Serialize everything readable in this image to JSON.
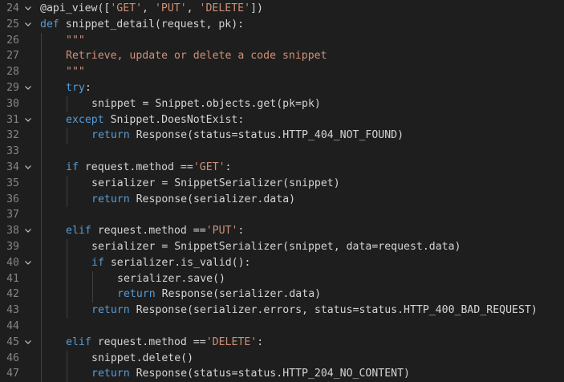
{
  "editor": {
    "lines": [
      {
        "n": "24",
        "fold": true,
        "indent": 0,
        "tokens": [
          {
            "c": "txt",
            "t": "@api_view(["
          },
          {
            "c": "str",
            "t": "'GET'"
          },
          {
            "c": "txt",
            "t": ", "
          },
          {
            "c": "str",
            "t": "'PUT'"
          },
          {
            "c": "txt",
            "t": ", "
          },
          {
            "c": "str",
            "t": "'DELETE'"
          },
          {
            "c": "txt",
            "t": "])"
          }
        ]
      },
      {
        "n": "25",
        "fold": true,
        "indent": 0,
        "tokens": [
          {
            "c": "kw",
            "t": "def"
          },
          {
            "c": "txt",
            "t": " snippet_detail(request, pk):"
          }
        ]
      },
      {
        "n": "26",
        "fold": false,
        "indent": 1,
        "tokens": [
          {
            "c": "cmt",
            "t": "\"\"\""
          }
        ]
      },
      {
        "n": "27",
        "fold": false,
        "indent": 1,
        "tokens": [
          {
            "c": "cmt",
            "t": "Retrieve, update or delete a code snippet"
          }
        ]
      },
      {
        "n": "28",
        "fold": false,
        "indent": 1,
        "tokens": [
          {
            "c": "cmt",
            "t": "\"\"\""
          }
        ]
      },
      {
        "n": "29",
        "fold": true,
        "indent": 1,
        "tokens": [
          {
            "c": "kw",
            "t": "try"
          },
          {
            "c": "txt",
            "t": ":"
          }
        ]
      },
      {
        "n": "30",
        "fold": false,
        "indent": 2,
        "tokens": [
          {
            "c": "txt",
            "t": "snippet = Snippet.objects.get(pk=pk)"
          }
        ]
      },
      {
        "n": "31",
        "fold": true,
        "indent": 1,
        "tokens": [
          {
            "c": "kw",
            "t": "except"
          },
          {
            "c": "txt",
            "t": " Snippet.DoesNotExist:"
          }
        ]
      },
      {
        "n": "32",
        "fold": false,
        "indent": 2,
        "tokens": [
          {
            "c": "kw",
            "t": "return"
          },
          {
            "c": "txt",
            "t": " Response(status=status.HTTP_404_NOT_FOUND)"
          }
        ]
      },
      {
        "n": "33",
        "fold": false,
        "indent": 0,
        "tokens": []
      },
      {
        "n": "34",
        "fold": true,
        "indent": 1,
        "tokens": [
          {
            "c": "kw",
            "t": "if"
          },
          {
            "c": "txt",
            "t": " request.method =="
          },
          {
            "c": "str",
            "t": "'GET'"
          },
          {
            "c": "txt",
            "t": ":"
          }
        ]
      },
      {
        "n": "35",
        "fold": false,
        "indent": 2,
        "tokens": [
          {
            "c": "txt",
            "t": "serializer = SnippetSerializer(snippet)"
          }
        ]
      },
      {
        "n": "36",
        "fold": false,
        "indent": 2,
        "tokens": [
          {
            "c": "kw",
            "t": "return"
          },
          {
            "c": "txt",
            "t": " Response(serializer.data)"
          }
        ]
      },
      {
        "n": "37",
        "fold": false,
        "indent": 0,
        "tokens": []
      },
      {
        "n": "38",
        "fold": true,
        "indent": 1,
        "tokens": [
          {
            "c": "kw",
            "t": "elif"
          },
          {
            "c": "txt",
            "t": " request.method =="
          },
          {
            "c": "str",
            "t": "'PUT'"
          },
          {
            "c": "txt",
            "t": ":"
          }
        ]
      },
      {
        "n": "39",
        "fold": false,
        "indent": 2,
        "tokens": [
          {
            "c": "txt",
            "t": "serializer = SnippetSerializer(snippet, data=request.data)"
          }
        ]
      },
      {
        "n": "40",
        "fold": true,
        "indent": 2,
        "tokens": [
          {
            "c": "kw",
            "t": "if"
          },
          {
            "c": "txt",
            "t": " serializer.is_valid():"
          }
        ]
      },
      {
        "n": "41",
        "fold": false,
        "indent": 3,
        "tokens": [
          {
            "c": "txt",
            "t": "serializer.save()"
          }
        ]
      },
      {
        "n": "42",
        "fold": false,
        "indent": 3,
        "tokens": [
          {
            "c": "kw",
            "t": "return"
          },
          {
            "c": "txt",
            "t": " Response(serializer.data)"
          }
        ]
      },
      {
        "n": "43",
        "fold": false,
        "indent": 2,
        "tokens": [
          {
            "c": "kw",
            "t": "return"
          },
          {
            "c": "txt",
            "t": " Response(serializer.errors, status=status.HTTP_400_BAD_REQUEST)"
          }
        ]
      },
      {
        "n": "44",
        "fold": false,
        "indent": 0,
        "tokens": []
      },
      {
        "n": "45",
        "fold": true,
        "indent": 1,
        "tokens": [
          {
            "c": "kw",
            "t": "elif"
          },
          {
            "c": "txt",
            "t": " request.method =="
          },
          {
            "c": "str",
            "t": "'DELETE'"
          },
          {
            "c": "txt",
            "t": ":"
          }
        ]
      },
      {
        "n": "46",
        "fold": false,
        "indent": 2,
        "tokens": [
          {
            "c": "txt",
            "t": "snippet.delete()"
          }
        ]
      },
      {
        "n": "47",
        "fold": false,
        "indent": 2,
        "tokens": [
          {
            "c": "kw",
            "t": "return"
          },
          {
            "c": "txt",
            "t": " Response(status=status.HTTP_204_NO_CONTENT)"
          }
        ]
      }
    ],
    "fold_icon": "chevron-down-icon",
    "colors": {
      "background": "#1e1e1e",
      "line_number": "#858585",
      "keyword": "#569cd6",
      "string": "#ce9178",
      "text": "#d4d4d4"
    }
  }
}
